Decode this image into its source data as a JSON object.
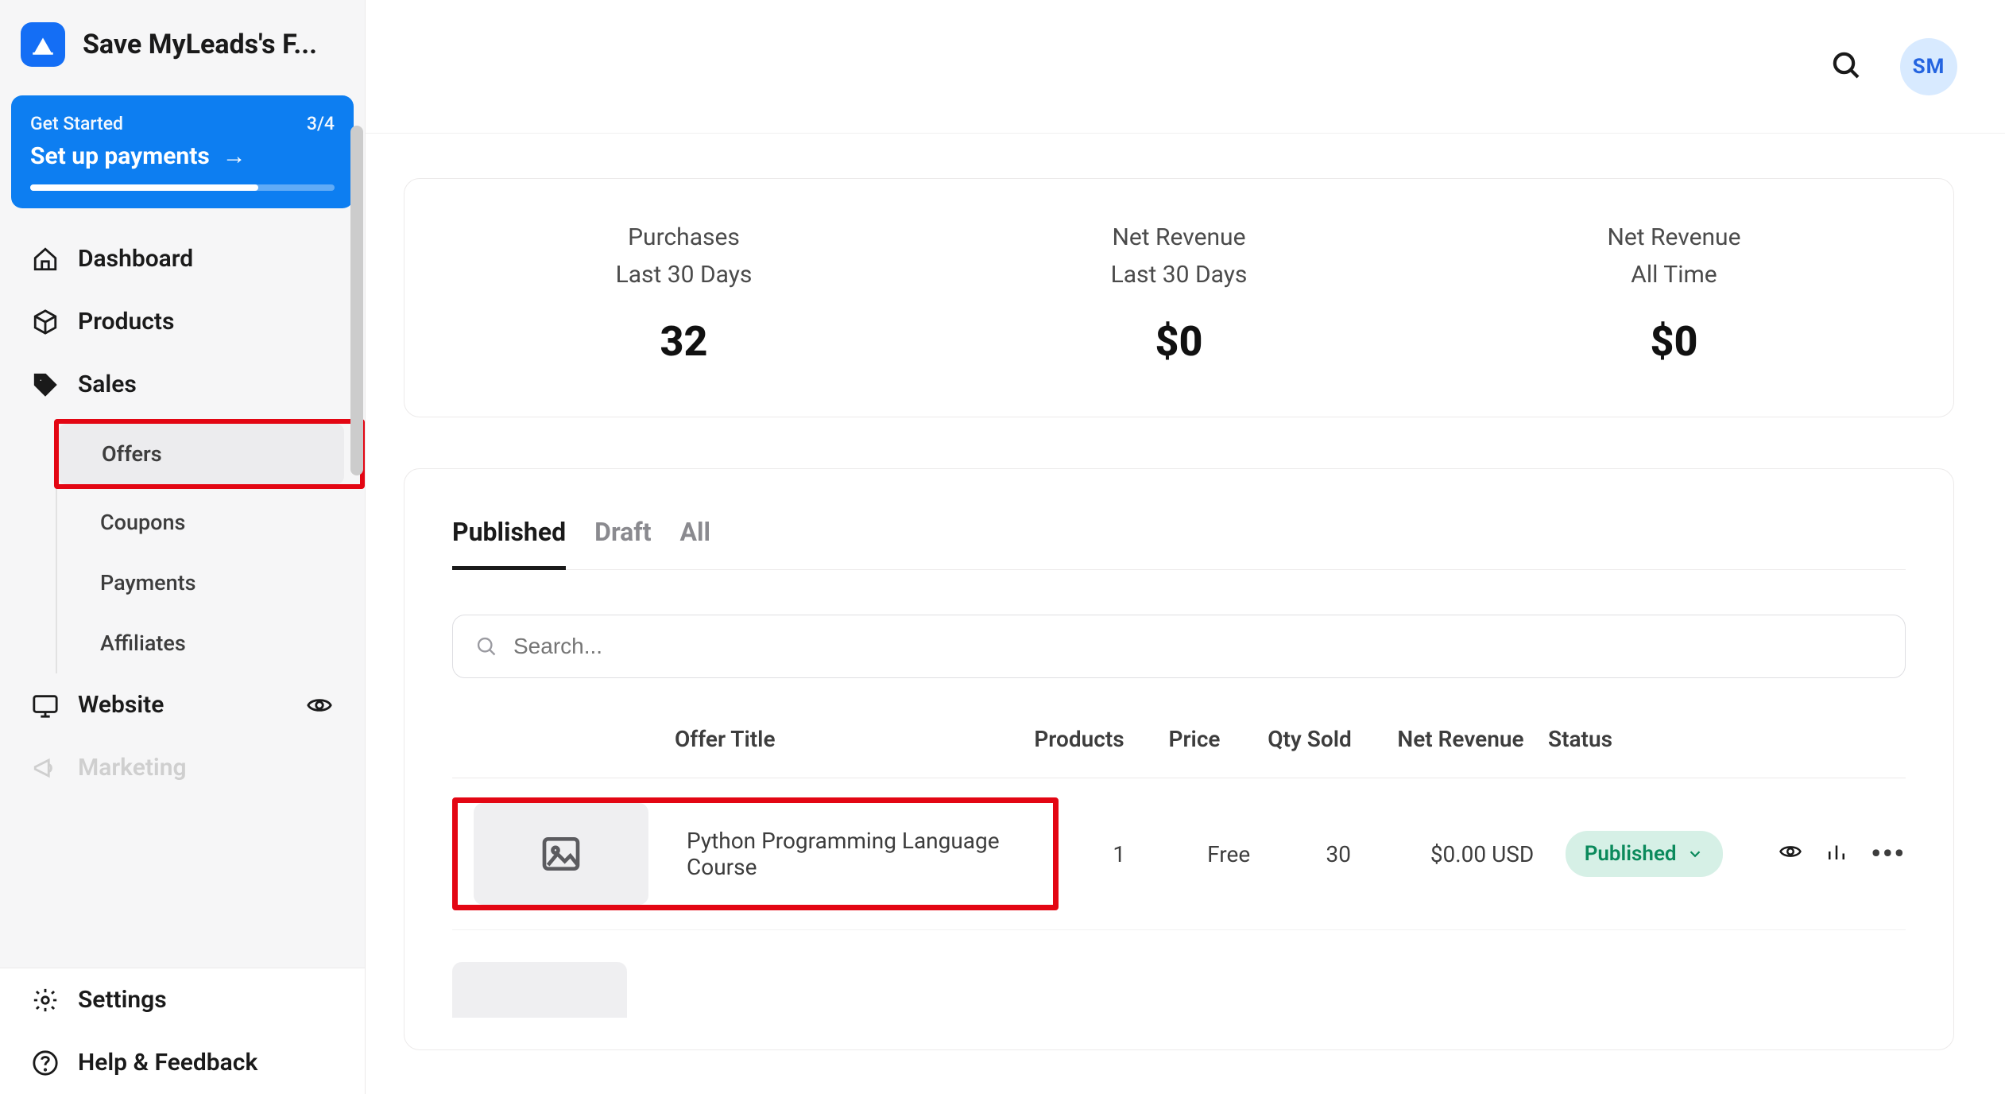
{
  "app": {
    "title": "Save MyLeads's F..."
  },
  "get_started": {
    "label": "Get Started",
    "progress_label": "3/4",
    "action": "Set up payments"
  },
  "sidebar": {
    "items": [
      {
        "label": "Dashboard"
      },
      {
        "label": "Products"
      },
      {
        "label": "Sales"
      },
      {
        "label": "Website"
      },
      {
        "label": "Marketing"
      }
    ],
    "sales_sub": [
      {
        "label": "Offers"
      },
      {
        "label": "Coupons"
      },
      {
        "label": "Payments"
      },
      {
        "label": "Affiliates"
      }
    ],
    "bottom": [
      {
        "label": "Settings"
      },
      {
        "label": "Help & Feedback"
      }
    ]
  },
  "topbar": {
    "avatar_initials": "SM"
  },
  "stats": [
    {
      "title": "Purchases",
      "sub": "Last 30 Days",
      "value": "32"
    },
    {
      "title": "Net Revenue",
      "sub": "Last 30 Days",
      "value": "$0"
    },
    {
      "title": "Net Revenue",
      "sub": "All Time",
      "value": "$0"
    }
  ],
  "tabs": {
    "published": "Published",
    "draft": "Draft",
    "all": "All"
  },
  "search": {
    "placeholder": "Search..."
  },
  "table": {
    "headers": {
      "title": "Offer Title",
      "products": "Products",
      "price": "Price",
      "qty": "Qty Sold",
      "revenue": "Net Revenue",
      "status": "Status"
    },
    "rows": [
      {
        "title": "Python Programming Language Course",
        "products": "1",
        "price": "Free",
        "qty": "30",
        "revenue": "$0.00 USD",
        "status": "Published"
      }
    ]
  }
}
